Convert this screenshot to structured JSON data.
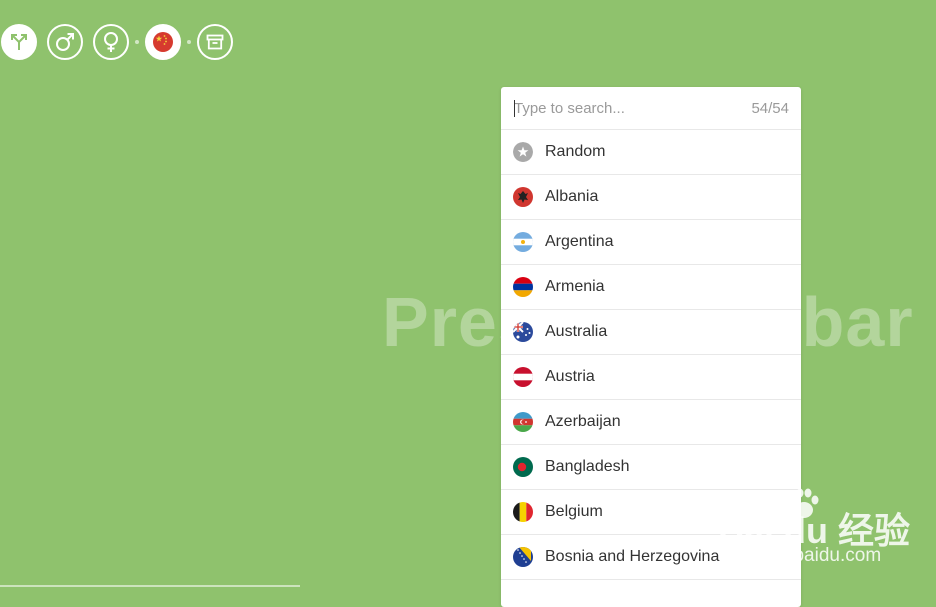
{
  "toolbar": {
    "buttons": [
      {
        "icon": "merge-arrows-icon"
      },
      {
        "icon": "male-icon"
      },
      {
        "icon": "female-icon"
      },
      {
        "icon": "china-flag-icon"
      },
      {
        "icon": "archive-box-icon"
      }
    ]
  },
  "watermark": "Press spacebar",
  "search": {
    "placeholder": "Type to search...",
    "count": "54/54"
  },
  "countries": [
    {
      "label": "Random",
      "flag": "random-star"
    },
    {
      "label": "Albania",
      "flag": "albania"
    },
    {
      "label": "Argentina",
      "flag": "argentina"
    },
    {
      "label": "Armenia",
      "flag": "armenia"
    },
    {
      "label": "Australia",
      "flag": "australia"
    },
    {
      "label": "Austria",
      "flag": "austria"
    },
    {
      "label": "Azerbaijan",
      "flag": "azerbaijan"
    },
    {
      "label": "Bangladesh",
      "flag": "bangladesh"
    },
    {
      "label": "Belgium",
      "flag": "belgium"
    },
    {
      "label": "Bosnia and Herzegovina",
      "flag": "bosnia"
    }
  ],
  "overlay": {
    "brand": "Bai du 经验",
    "url": "jingyan.baidu.com"
  },
  "colors": {
    "background": "#8fc26d",
    "panel": "#ffffff",
    "text": "#333333",
    "muted": "#9a9a9a"
  }
}
